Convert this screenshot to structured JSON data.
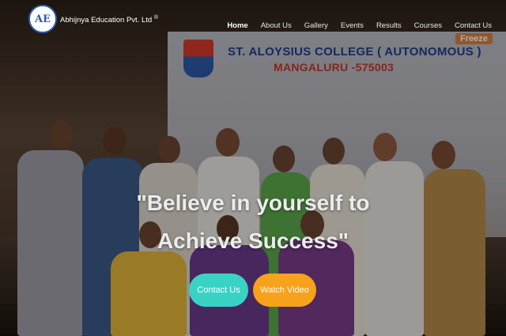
{
  "header": {
    "brand_name": "Abhijnya Education Pvt. Ltd",
    "brand_mark": "®",
    "logo_text": "AE"
  },
  "nav": {
    "items": [
      {
        "label": "Home",
        "active": true
      },
      {
        "label": "About Us",
        "active": false
      },
      {
        "label": "Gallery",
        "active": false
      },
      {
        "label": "Events",
        "active": false
      },
      {
        "label": "Results",
        "active": false
      },
      {
        "label": "Courses",
        "active": false
      },
      {
        "label": "Contact Us",
        "active": false
      }
    ]
  },
  "hero": {
    "banner_title": "ST. ALOYSIUS COLLEGE ( AUTONOMOUS )",
    "banner_subtitle": "MANGALURU -575003",
    "banner_tag": "Freeze",
    "headline_line1": "\"Believe in yourself to",
    "headline_line2": "Achieve Success\"",
    "buttons": {
      "contact_label": "Contact Us",
      "video_label": "Watch Video"
    }
  },
  "colors": {
    "contact_button": "#39d3c6",
    "video_button": "#f7a21b"
  }
}
